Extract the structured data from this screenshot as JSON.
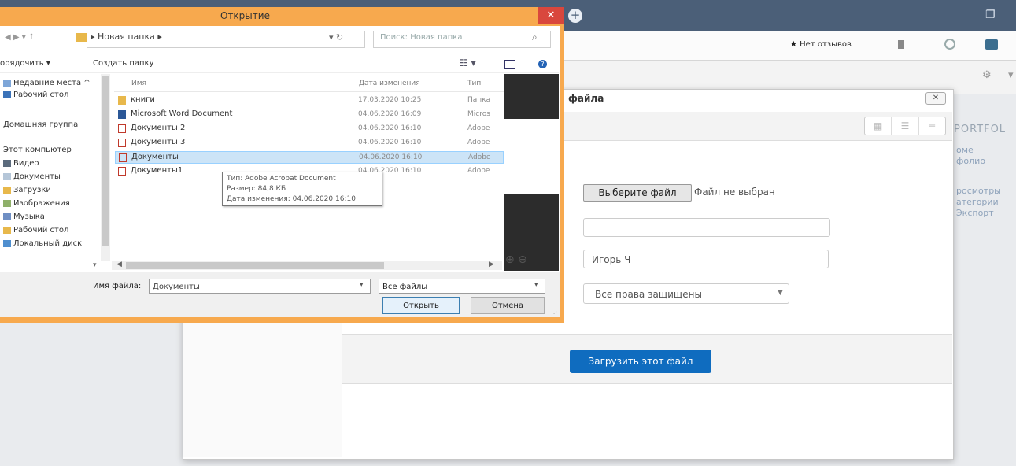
{
  "browser": {
    "no_reviews": "★ Нет отзывов"
  },
  "sidebar": {
    "portfolio": "PORTFOL",
    "links": [
      "оме",
      "фолио",
      "росмотры",
      "атегории",
      "Экспорт"
    ]
  },
  "upload_modal": {
    "title": "файла",
    "close_label": "✕",
    "choose_file_label": "Выберите файл",
    "no_file_text": "Файл не выбран",
    "name_value": "",
    "author_value": "Игорь Ч",
    "license_value": "Все права защищены",
    "upload_label": "Загрузить этот файл",
    "colors": {
      "primary": "#0f6cbf"
    }
  },
  "open_dialog": {
    "title": "Открытие",
    "close_label": "✕",
    "path": "▸ Новая папка ▸",
    "search_placeholder": "Поиск: Новая папка",
    "organize_label": "орядочить ▾",
    "new_folder_label": "Создать папку",
    "nav_items": [
      {
        "label": "Недавние места ^",
        "icon": "recent-places-icon"
      },
      {
        "label": "Рабочий стол",
        "icon": "desktop-icon"
      },
      {
        "label": "Домашняя группа",
        "icon": "homegroup-icon"
      },
      {
        "label": "Этот компьютер",
        "icon": "computer-icon"
      },
      {
        "label": "Видео",
        "icon": "video-icon"
      },
      {
        "label": "Документы",
        "icon": "documents-icon"
      },
      {
        "label": "Загрузки",
        "icon": "downloads-icon"
      },
      {
        "label": "Изображения",
        "icon": "pictures-icon"
      },
      {
        "label": "Музыка",
        "icon": "music-icon"
      },
      {
        "label": "Рабочий стол",
        "icon": "desktop-icon"
      },
      {
        "label": "Локальный диск",
        "icon": "drive-icon"
      }
    ],
    "columns": {
      "name": "Имя",
      "date": "Дата изменения",
      "type": "Тип"
    },
    "files": [
      {
        "name": "книги",
        "date": "17.03.2020 10:25",
        "type": "Папка",
        "icon": "folder-icon"
      },
      {
        "name": "Microsoft Word Document",
        "date": "04.06.2020 16:09",
        "type": "Micros",
        "icon": "word-icon"
      },
      {
        "name": "Документы 2",
        "date": "04.06.2020 16:10",
        "type": "Adobe",
        "icon": "pdf-icon"
      },
      {
        "name": "Документы 3",
        "date": "04.06.2020 16:10",
        "type": "Adobe",
        "icon": "pdf-icon"
      },
      {
        "name": "Документы",
        "date": "04.06.2020 16:10",
        "type": "Adobe",
        "icon": "pdf-icon"
      },
      {
        "name": "Документы1",
        "date": "04.06.2020 16:10",
        "type": "Adobe",
        "icon": "pdf-icon"
      }
    ],
    "tooltip": {
      "type": "Тип: Adobe Acrobat Document",
      "size": "Размер: 84,8 КБ",
      "modified": "Дата изменения: 04.06.2020 16:10"
    },
    "file_name_label": "Имя файла:",
    "file_name_value": "Документы",
    "filter_value": "Все файлы",
    "open_label": "Открыть",
    "cancel_label": "Отмена",
    "colors": {
      "frame": "#f7a94e",
      "close": "#d9473d",
      "selection": "#cce4f7"
    }
  }
}
